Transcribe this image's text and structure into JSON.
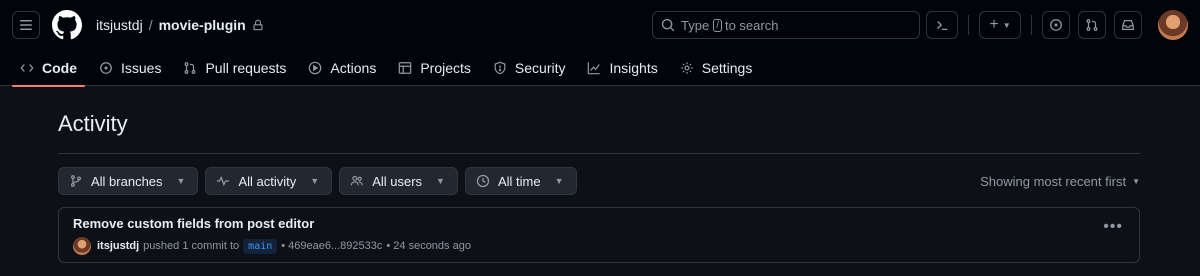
{
  "header": {
    "owner": "itsjustdj",
    "separator": "/",
    "repo": "movie-plugin",
    "search": {
      "prefix": "Type",
      "key": "/",
      "suffix": "to search"
    },
    "plus_symbol": "+"
  },
  "tabs": [
    {
      "label": "Code",
      "icon": "code-icon",
      "active": true
    },
    {
      "label": "Issues",
      "icon": "issue-icon"
    },
    {
      "label": "Pull requests",
      "icon": "pull-request-icon"
    },
    {
      "label": "Actions",
      "icon": "play-icon"
    },
    {
      "label": "Projects",
      "icon": "table-icon"
    },
    {
      "label": "Security",
      "icon": "shield-icon"
    },
    {
      "label": "Insights",
      "icon": "graph-icon"
    },
    {
      "label": "Settings",
      "icon": "gear-icon"
    }
  ],
  "page": {
    "title": "Activity"
  },
  "filters": {
    "branches": "All branches",
    "activity": "All activity",
    "users": "All users",
    "time": "All time",
    "sort": "Showing most recent first"
  },
  "activity": [
    {
      "title": "Remove custom fields from post editor",
      "user": "itsjustdj",
      "action": "pushed 1 commit to",
      "branch": "main",
      "commit_range": "• 469eae6...892533c",
      "time": "• 24 seconds ago"
    }
  ],
  "colors": {
    "accent": "#f78166",
    "link": "#4493f8",
    "background": "#0d1117"
  }
}
